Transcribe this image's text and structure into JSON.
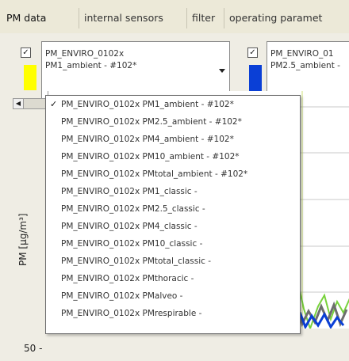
{
  "tabs": [
    {
      "label": "PM data"
    },
    {
      "label": "internal sensors"
    },
    {
      "label": "filter"
    },
    {
      "label": "operating paramet"
    }
  ],
  "sensors": [
    {
      "line1": "PM_ENVIRO_0102x",
      "line2": "PM1_ambient - #102*",
      "color": "#ffff00",
      "checked": "✓"
    },
    {
      "line1": "PM_ENVIRO_01",
      "line2": "PM2.5_ambient -",
      "color": "#0a3fd6",
      "checked": "✓"
    }
  ],
  "dropdown": {
    "items": [
      {
        "label": "PM_ENVIRO_0102x PM1_ambient - #102*",
        "selected": "✓"
      },
      {
        "label": "PM_ENVIRO_0102x PM2.5_ambient - #102*",
        "selected": ""
      },
      {
        "label": "PM_ENVIRO_0102x PM4_ambient - #102*",
        "selected": ""
      },
      {
        "label": "PM_ENVIRO_0102x PM10_ambient - #102*",
        "selected": ""
      },
      {
        "label": "PM_ENVIRO_0102x PMtotal_ambient - #102*",
        "selected": ""
      },
      {
        "label": "PM_ENVIRO_0102x PM1_classic -",
        "selected": ""
      },
      {
        "label": "PM_ENVIRO_0102x PM2.5_classic -",
        "selected": ""
      },
      {
        "label": "PM_ENVIRO_0102x PM4_classic -",
        "selected": ""
      },
      {
        "label": "PM_ENVIRO_0102x PM10_classic -",
        "selected": ""
      },
      {
        "label": "PM_ENVIRO_0102x PMtotal_classic -",
        "selected": ""
      },
      {
        "label": "PM_ENVIRO_0102x PMthoracic -",
        "selected": ""
      },
      {
        "label": "PM_ENVIRO_0102x PMalveo -",
        "selected": ""
      },
      {
        "label": "PM_ENVIRO_0102x PMrespirable -",
        "selected": ""
      }
    ]
  },
  "chart": {
    "ylabel": "PM [µg/m³]",
    "ytick": "50 -"
  }
}
